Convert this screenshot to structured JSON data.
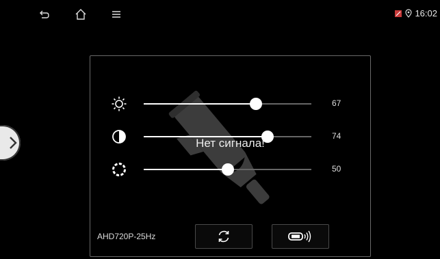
{
  "statusbar": {
    "icons": [
      "back-icon",
      "home-icon",
      "menu-icon",
      "sim-icon",
      "location-icon"
    ],
    "clock": "16:02"
  },
  "panel": {
    "message": "Нет сигнала!",
    "mode_label": "AHD720P-25Hz",
    "sliders": [
      {
        "icon": "brightness-icon",
        "value": 67,
        "value_text": "67"
      },
      {
        "icon": "contrast-icon",
        "value": 74,
        "value_text": "74"
      },
      {
        "icon": "saturation-icon",
        "value": 50,
        "value_text": "50"
      }
    ],
    "buttons": [
      {
        "icon": "refresh-icon"
      },
      {
        "icon": "camera-switch-icon"
      }
    ],
    "watermark_icon": "camera-icon"
  },
  "colors": {
    "background": "#000000",
    "accent": "#ffffff",
    "track": "#666666"
  }
}
